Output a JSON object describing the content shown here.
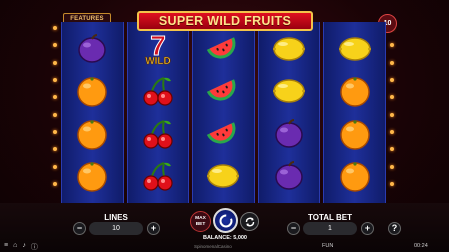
{
  "game": {
    "title": "SUPER WILD FRUITS",
    "features_label": "FEATURES",
    "lines_badge": "10"
  },
  "reels": [
    [
      "plum",
      "orange",
      "orange",
      "orange"
    ],
    [
      "seven-wild",
      "cherries",
      "cherries",
      "cherries"
    ],
    [
      "watermelon",
      "watermelon",
      "watermelon",
      "lemon"
    ],
    [
      "lemon",
      "lemon",
      "plum",
      "plum"
    ],
    [
      "lemon",
      "orange",
      "orange",
      "orange"
    ]
  ],
  "symbol_colors": {
    "plum": "#6a2bb0",
    "orange": "#ff9a10",
    "cherries": "#e0101a",
    "watermelon": "#2aa84a",
    "lemon": "#f7d21a",
    "seven": "#d01020"
  },
  "wild_label": "WILD",
  "controls": {
    "lines_label": "LINES",
    "lines_value": "10",
    "total_bet_label": "TOTAL BET",
    "total_bet_value": "1",
    "max_bet_label": "MAX BET",
    "balance_text": "BALANCE: 5,000",
    "minus_symbol": "−",
    "plus_symbol": "+",
    "help_symbol": "?"
  },
  "footer": {
    "menu_icon": "≡",
    "home_icon": "⌂",
    "sound_icon": "♪",
    "info_icon": "ⓘ",
    "brand": "SpinomenalCasino",
    "mode": "FUN",
    "time": "00:24"
  }
}
